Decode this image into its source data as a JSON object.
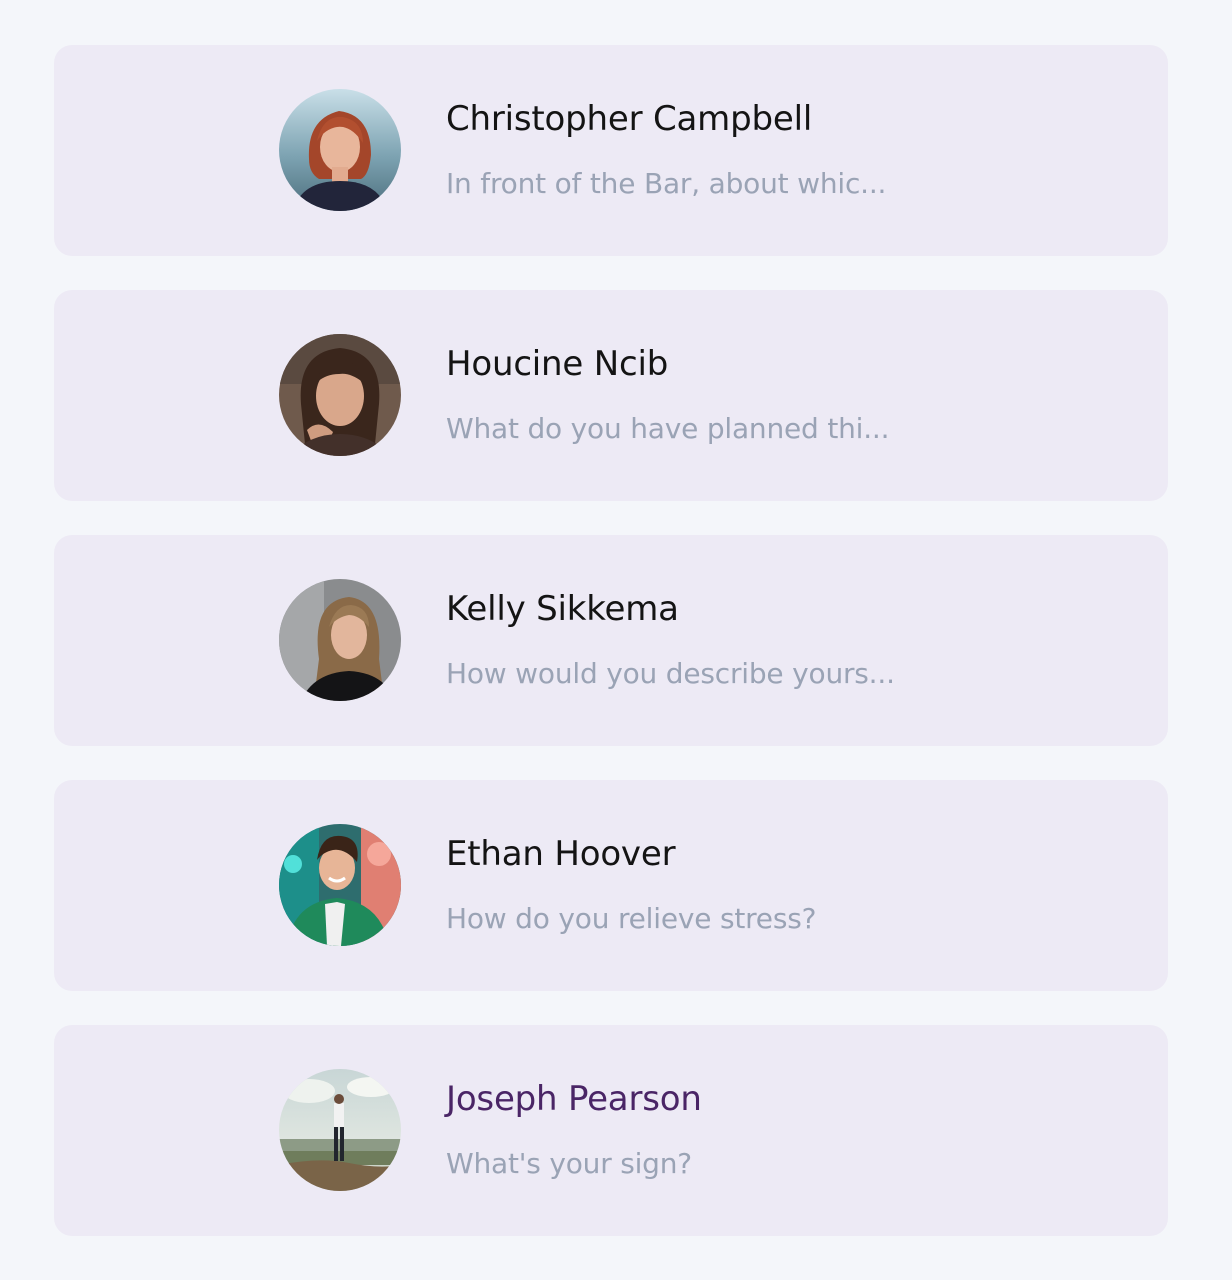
{
  "conversations": [
    {
      "name": "Christopher Campbell",
      "preview": "In front of the Bar, about whic...",
      "avatar_icon": "avatar-woman-red-hair",
      "highlighted": false
    },
    {
      "name": "Houcine Ncib",
      "preview": "What do you have planned thi...",
      "avatar_icon": "avatar-woman-dark-hair",
      "highlighted": false
    },
    {
      "name": "Kelly Sikkema",
      "preview": "How would you describe yours...",
      "avatar_icon": "avatar-woman-blonde",
      "highlighted": false
    },
    {
      "name": "Ethan Hoover",
      "preview": "How do you relieve stress?",
      "avatar_icon": "avatar-man-green-shirt",
      "highlighted": false
    },
    {
      "name": "Joseph Pearson",
      "preview": "What's your sign?",
      "avatar_icon": "avatar-man-landscape",
      "highlighted": true
    }
  ],
  "colors": {
    "page_background": "#f4f6fa",
    "card_background": "#edeaf5",
    "name_text": "#141414",
    "highlight_name_text": "#4a2566",
    "preview_text": "#9aa3b5"
  }
}
